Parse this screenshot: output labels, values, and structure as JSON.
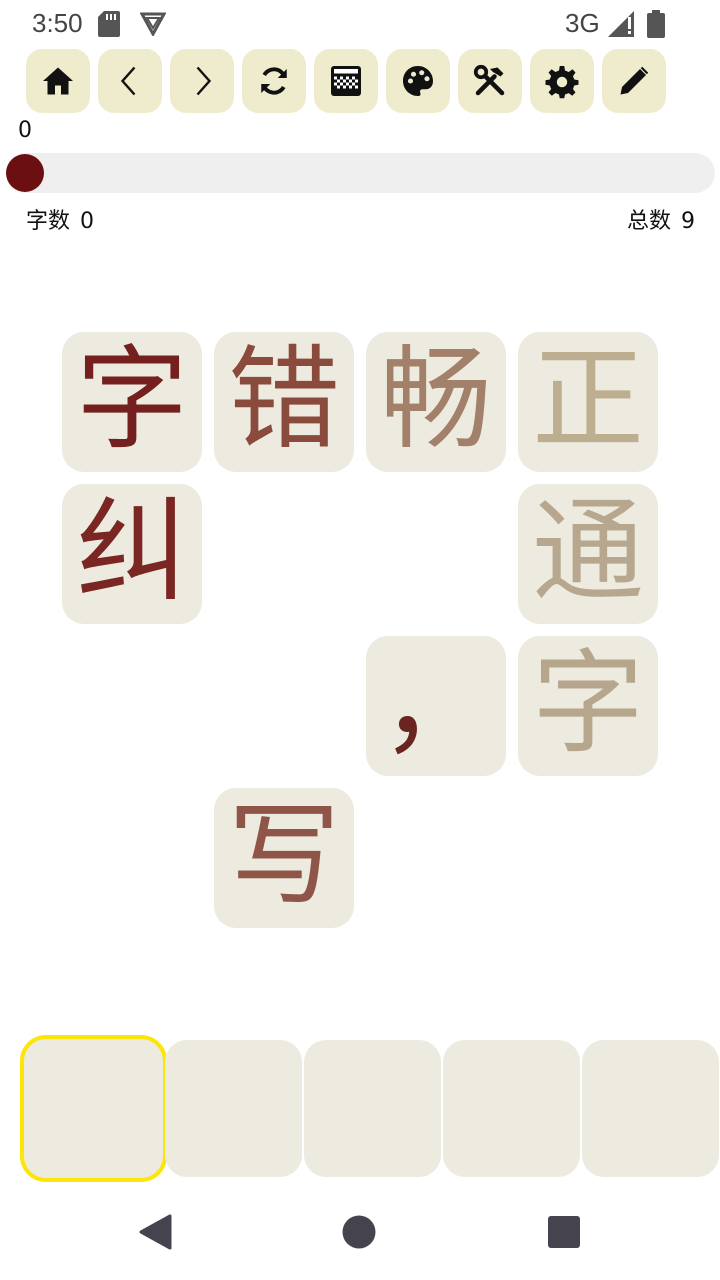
{
  "status_bar": {
    "time": "3:50",
    "network": "3G",
    "icons": [
      "sd-card-icon",
      "vpn-shield-icon",
      "signal-icon",
      "battery-icon"
    ]
  },
  "toolbar": {
    "buttons": [
      {
        "name": "home-button",
        "icon": "home-icon"
      },
      {
        "name": "previous-button",
        "icon": "chevron-left-icon"
      },
      {
        "name": "next-button",
        "icon": "chevron-right-icon"
      },
      {
        "name": "refresh-button",
        "icon": "refresh-icon"
      },
      {
        "name": "keyboard-button",
        "icon": "grid-pattern-icon"
      },
      {
        "name": "theme-button",
        "icon": "palette-icon"
      },
      {
        "name": "tools-button",
        "icon": "tools-icon"
      },
      {
        "name": "settings-button",
        "icon": "gear-icon"
      },
      {
        "name": "edit-button",
        "icon": "pencil-icon"
      }
    ]
  },
  "progress": {
    "value": "0",
    "fraction": 0,
    "char_count_label": "字数",
    "char_count_value": "0",
    "total_label": "总数",
    "total_value": "9"
  },
  "grid": {
    "tiles": [
      {
        "char": "字",
        "color": "#74201f"
      },
      {
        "char": "错",
        "color": "#8a4a3c"
      },
      {
        "char": "畅",
        "color": "#a2806a"
      },
      {
        "char": "正",
        "color": "#bcae8e"
      },
      {
        "char": "纠",
        "color": "#7a2623"
      },
      {
        "char": "通",
        "color": "#b6a78e"
      },
      {
        "char": "，",
        "color": "#6b2520"
      },
      {
        "char": "字",
        "color": "#b6a68b"
      },
      {
        "char": "写",
        "color": "#8e5548"
      }
    ]
  },
  "answer_slots": {
    "count": 5,
    "active_index": 0,
    "active_color": "#fbe50a"
  },
  "nav_bar": {
    "buttons": [
      "back-icon",
      "home-circle-icon",
      "recents-icon"
    ]
  }
}
